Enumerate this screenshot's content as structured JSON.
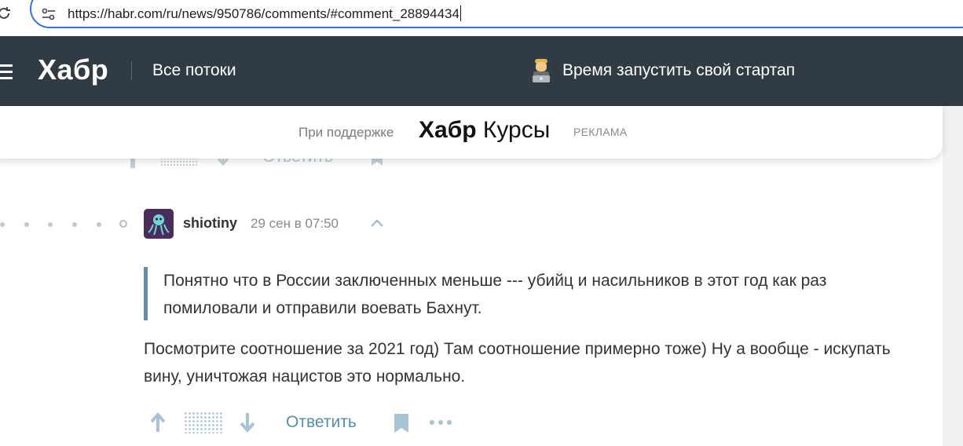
{
  "browser": {
    "url": "https://habr.com/ru/news/950786/comments/#comment_28894434"
  },
  "header": {
    "logo": "Хабр",
    "all_streams": "Все потоки",
    "promo_text": "Время запустить свой стартап",
    "bg_color": "#303b44"
  },
  "sponsor": {
    "label": "При поддержке",
    "brand_bold": "Хабр",
    "brand_regular": " Курсы",
    "ad_label": "РЕКЛАМА"
  },
  "ghost_controls": {
    "reply_label": "Ответить"
  },
  "comment": {
    "username": "shiotiny",
    "timestamp": "29 сен в 07:50",
    "quote": "Понятно что в России заключенных меньше --- убийц и насильников в этот год как раз помиловали и отправили воевать Бахнут.",
    "body": "Посмотрите соотношение за 2021 год) Там соотношение примерно тоже) Ну а вообще - искупать вину, уничтожая нацистов это нормально.",
    "actions": {
      "reply_label": "Ответить"
    },
    "accent_color": "#548eaa"
  },
  "icons": {
    "reload": "reload-icon",
    "site_settings": "tune-icon",
    "menu": "burger-menu-icon",
    "promo": "programmer-emoji-icon",
    "vote_up": "arrow-up-icon",
    "vote_down": "arrow-down-icon",
    "bookmark": "bookmark-icon",
    "more": "more-dots-icon",
    "parent": "chevron-up-icon"
  }
}
